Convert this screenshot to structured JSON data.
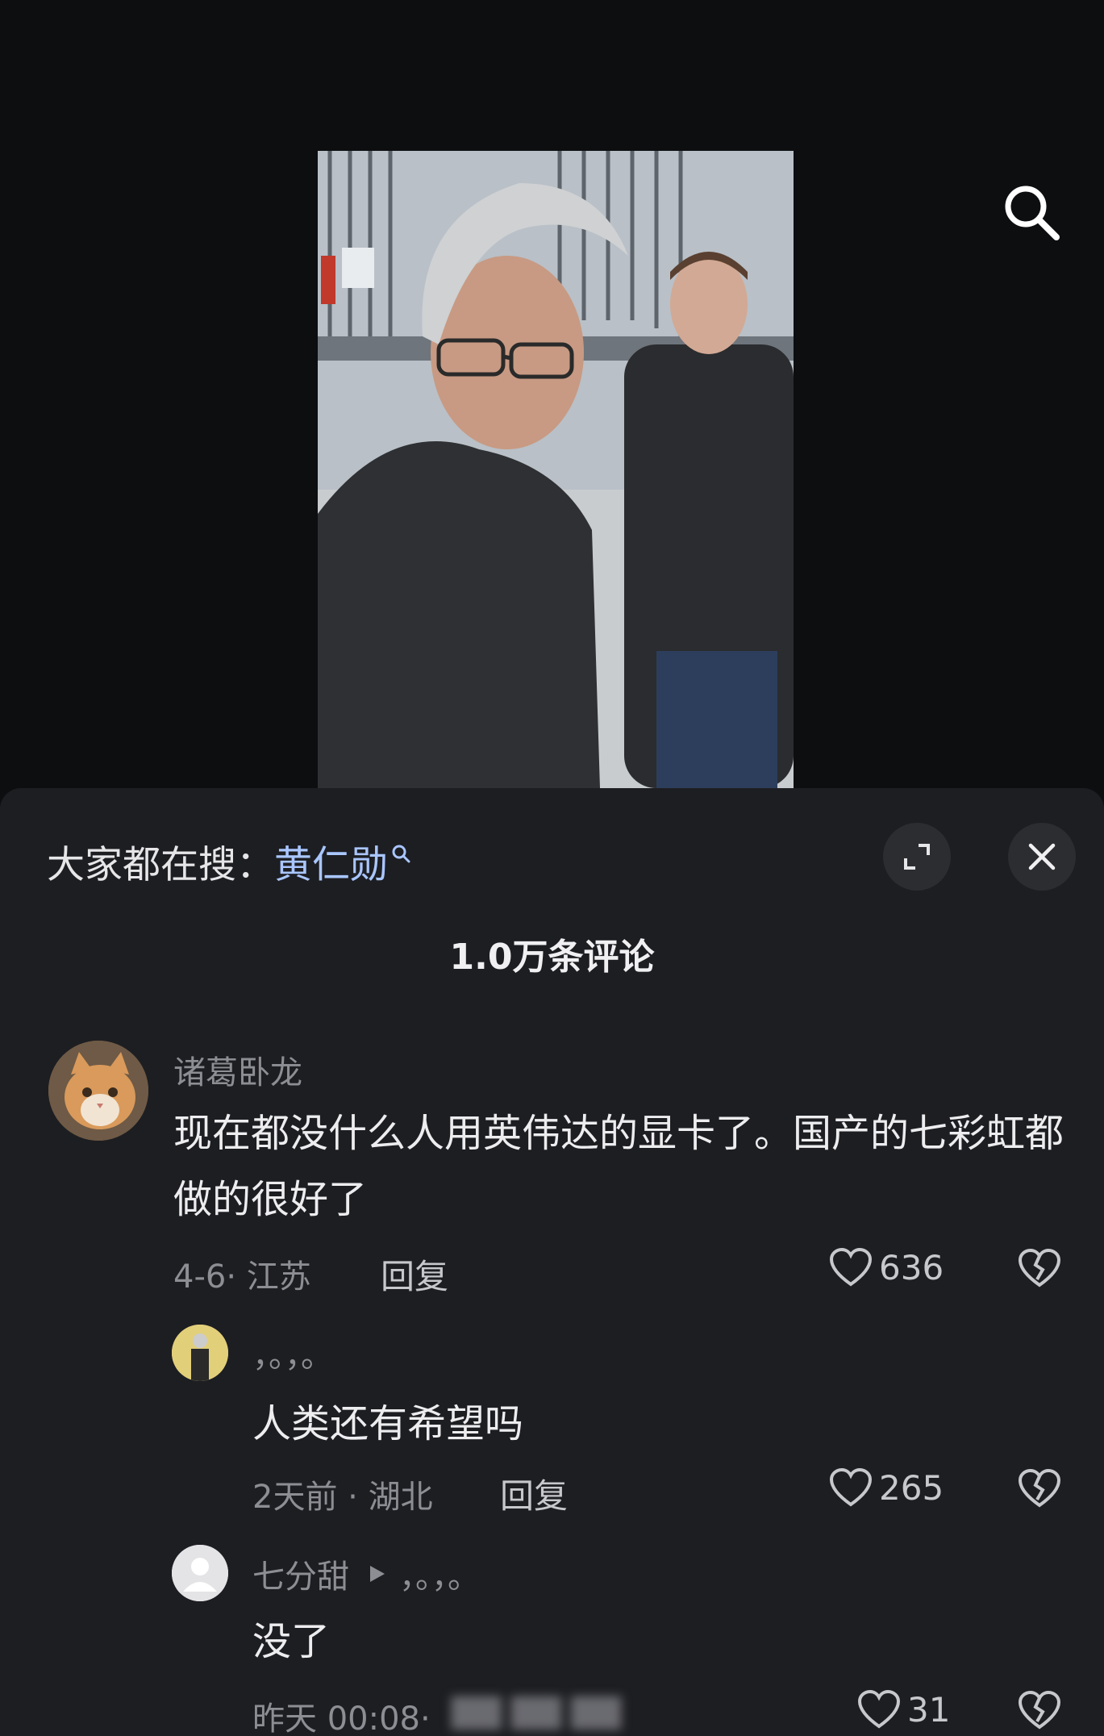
{
  "hot_search": {
    "prefix": "大家都在搜：",
    "keyword": "黄仁勋"
  },
  "comments_header": {
    "count_label": "1.0万条评论"
  },
  "comments": [
    {
      "username": "诸葛卧龙",
      "text": "现在都没什么人用英伟达的显卡了。国产的七彩虹都做的很好了",
      "date": "4-6",
      "location": "江苏",
      "reply_label": "回复",
      "likes": "636"
    },
    {
      "username": "，。，。",
      "text": "人类还有希望吗",
      "date": "2天前",
      "location": "湖北",
      "reply_label": "回复",
      "likes": "265"
    },
    {
      "username": "七分甜",
      "reply_to": "，。，。",
      "text": "没了",
      "date": "昨天 00:08",
      "location": "",
      "likes": "31"
    }
  ],
  "icons": {
    "search": "search-icon",
    "expand": "expand-icon",
    "close": "close-icon",
    "like": "heart-icon",
    "dislike": "broken-heart-icon"
  },
  "colors": {
    "background": "#0d0e10",
    "sheet": "#1d1e22",
    "keyword": "#a9c6ff"
  }
}
